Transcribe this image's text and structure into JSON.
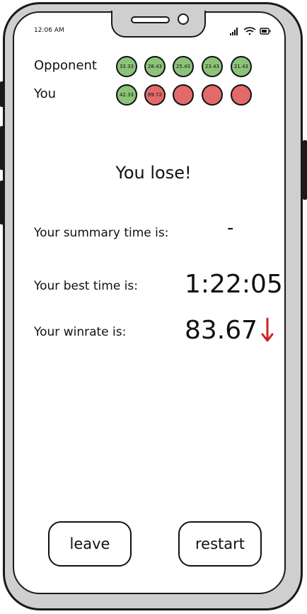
{
  "status_bar": {
    "time": "12:06 AM"
  },
  "scoreboard": {
    "opponent_label": "Opponent",
    "you_label": "You",
    "opponent_times": [
      "33.33",
      "28.43",
      "25.43",
      "23.43",
      "21.43"
    ],
    "you_times": [
      "42.33",
      "89.72",
      "",
      "",
      ""
    ],
    "opponent_results": [
      "win",
      "win",
      "win",
      "win",
      "win"
    ],
    "you_results": [
      "win",
      "loss",
      "loss",
      "loss",
      "loss"
    ]
  },
  "result": {
    "message": "You lose!"
  },
  "stats": {
    "summary_label": "Your summary time is:",
    "summary_value": "-",
    "best_label": "Your best time is:",
    "best_value": "1:22:05",
    "winrate_label": "Your winrate is:",
    "winrate_value": "83.67",
    "winrate_trend": "down-arrow-icon"
  },
  "actions": {
    "leave_label": "leave",
    "restart_label": "restart"
  },
  "colors": {
    "win": "#8cc379",
    "loss": "#e26a6a",
    "trend_down": "#cc2222",
    "frame": "#cfcfcf"
  }
}
